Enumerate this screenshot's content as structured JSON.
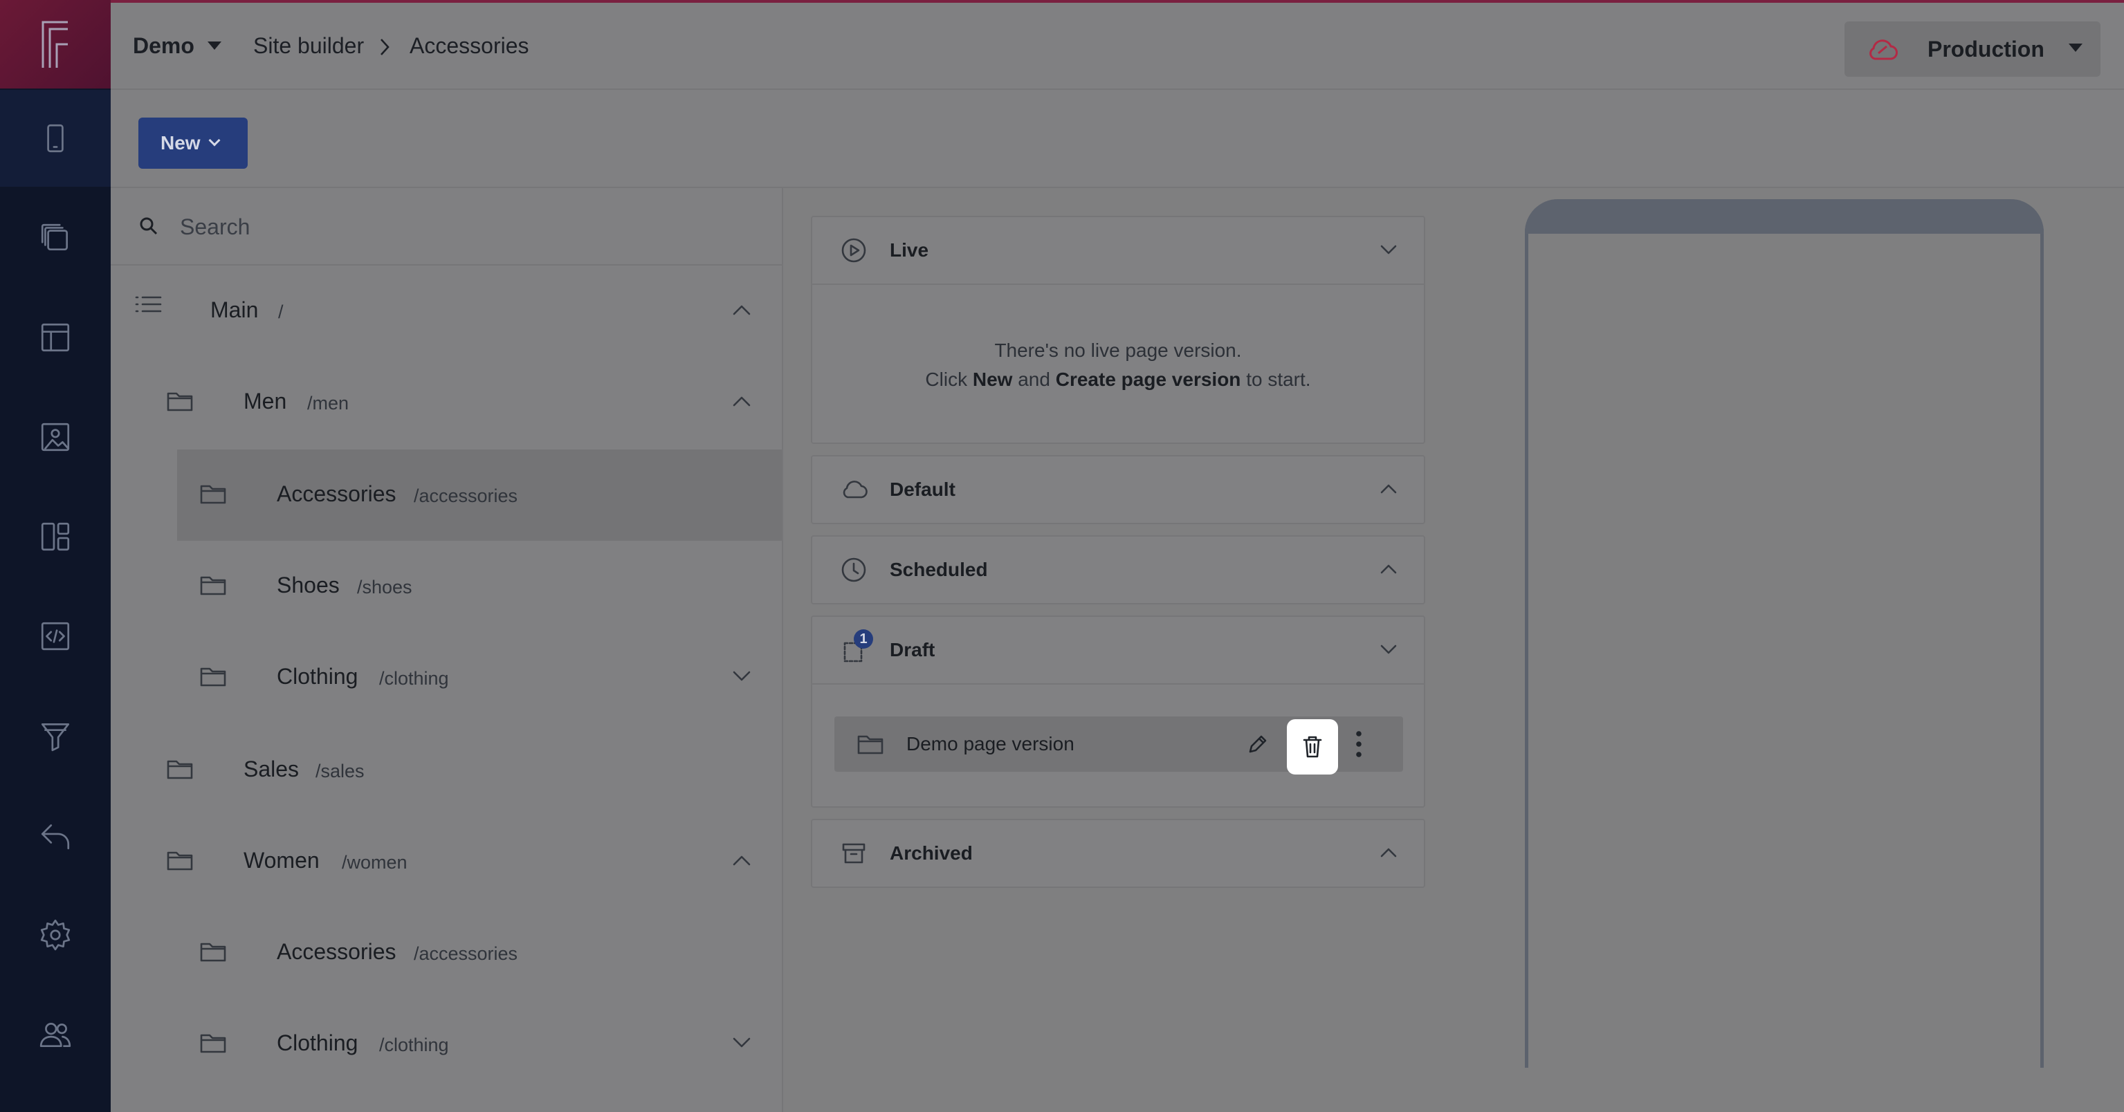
{
  "rail": {
    "logo_icon": "brand-logo-icon",
    "items": [
      {
        "name": "mobile-icon",
        "active": true
      },
      {
        "name": "pages-icon"
      },
      {
        "name": "layout-icon"
      },
      {
        "name": "image-icon"
      },
      {
        "name": "components-icon"
      },
      {
        "name": "code-icon"
      },
      {
        "name": "filter-icon"
      },
      {
        "name": "undo-icon"
      },
      {
        "name": "settings-icon"
      },
      {
        "name": "users-icon"
      }
    ]
  },
  "header": {
    "project": "Demo",
    "breadcrumb": [
      "Site builder",
      "Accessories"
    ],
    "environment": "Production",
    "environment_icon": "cloud-alert-icon",
    "status_color": "#b32a45"
  },
  "toolbar": {
    "new_label": "New"
  },
  "search": {
    "placeholder": "Search"
  },
  "tree": [
    {
      "name": "Main",
      "path": "/",
      "chevron": "up"
    },
    {
      "name": "Men",
      "path": "/men",
      "chevron": "up"
    },
    {
      "name": "Accessories",
      "path": "/accessories",
      "selected": true
    },
    {
      "name": "Shoes",
      "path": "/shoes"
    },
    {
      "name": "Clothing",
      "path": "/clothing",
      "chevron": "down"
    },
    {
      "name": "Sales",
      "path": "/sales"
    },
    {
      "name": "Women",
      "path": "/women",
      "chevron": "up"
    },
    {
      "name": "Accessories",
      "path": "/accessories"
    },
    {
      "name": "Clothing",
      "path": "/clothing",
      "chevron": "down"
    }
  ],
  "versions": {
    "live": {
      "title": "Live",
      "empty_line1": "There's no live page version.",
      "empty_click": "Click",
      "empty_new": "New",
      "empty_and": "and",
      "empty_create": "Create page version",
      "empty_end": "to start."
    },
    "default": {
      "title": "Default"
    },
    "scheduled": {
      "title": "Scheduled"
    },
    "draft": {
      "title": "Draft",
      "badge": "1",
      "items": [
        {
          "name": "Demo page version"
        }
      ]
    },
    "archived": {
      "title": "Archived"
    }
  },
  "accent": "#263d7c"
}
